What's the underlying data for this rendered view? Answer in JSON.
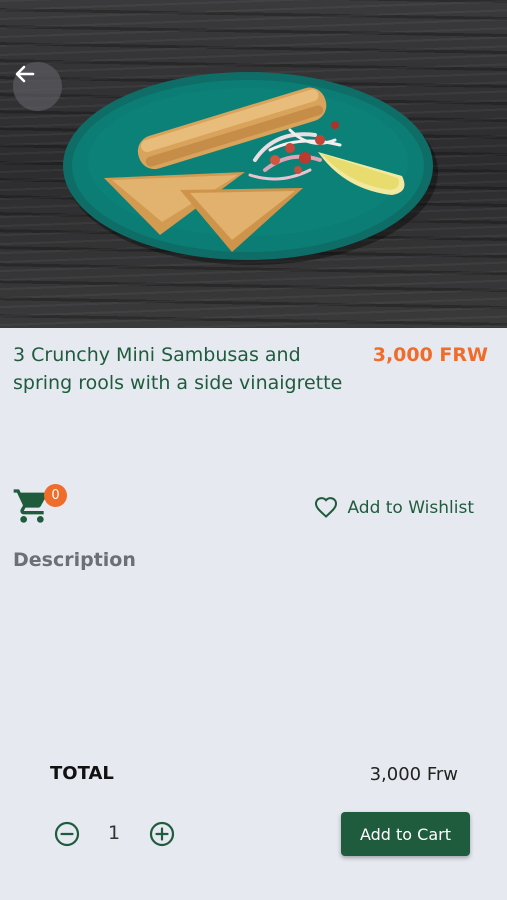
{
  "product": {
    "image_alt": "food-photo",
    "title": "3 Crunchy Mini Sambusas and spring rools with a side vinaigrette",
    "price": "3,000 FRW"
  },
  "cart": {
    "count": "0"
  },
  "wishlist": {
    "label": "Add to Wishlist"
  },
  "description": {
    "label": "Description"
  },
  "summary": {
    "total_label": "TOTAL",
    "total_value": "3,000 Frw",
    "quantity": "1"
  },
  "actions": {
    "add_to_cart": "Add to Cart"
  },
  "colors": {
    "brand_green": "#1f5c3d",
    "accent_orange": "#ef6c2a",
    "background": "#e6e9f0"
  }
}
